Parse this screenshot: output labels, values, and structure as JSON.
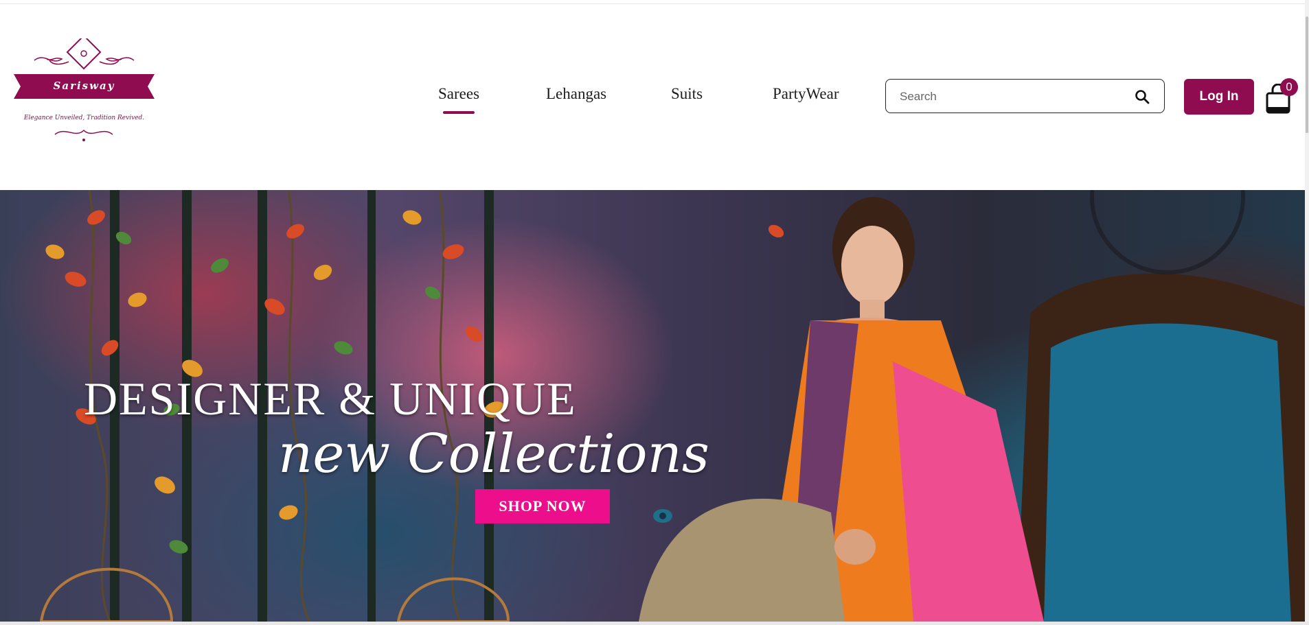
{
  "brand": {
    "name": "Sarisway",
    "tagline": "Elegance Unveiled, Tradition Revived."
  },
  "nav": {
    "items": [
      {
        "label": "Sarees",
        "active": true
      },
      {
        "label": "Lehangas",
        "active": false
      },
      {
        "label": "Suits",
        "active": false
      },
      {
        "label": "PartyWear",
        "active": false
      }
    ]
  },
  "search": {
    "placeholder": "Search",
    "value": ""
  },
  "auth": {
    "login_label": "Log In"
  },
  "cart": {
    "count": "0"
  },
  "hero": {
    "title_line1": "DESIGNER & UNIQUE",
    "title_line2": "new Collections",
    "cta_label": "SHOP NOW"
  },
  "colors": {
    "brand": "#8e0c4f",
    "cta": "#ec0e8a"
  }
}
